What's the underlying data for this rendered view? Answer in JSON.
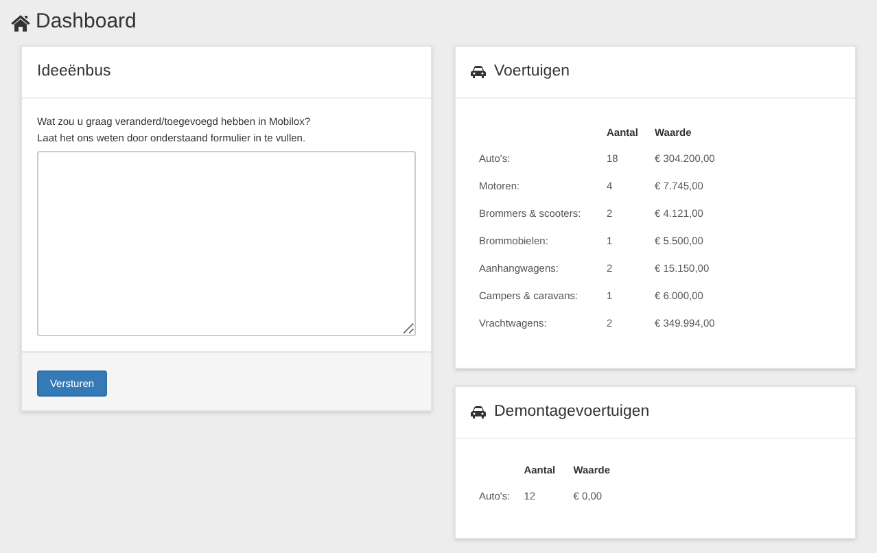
{
  "page_title": "Dashboard",
  "idea_box": {
    "title": "Ideeënbus",
    "intro": [
      "Wat zou u graag veranderd/toegevoegd hebben in Mobilox?",
      "Laat het ons weten door onderstaand formulier in te vullen."
    ],
    "submit": "Versturen"
  },
  "vehicles": {
    "title": "Voertuigen",
    "columns": [
      "Aantal",
      "Waarde"
    ],
    "rows": [
      {
        "label": "Auto's:",
        "count": "18",
        "value": "€ 304.200,00"
      },
      {
        "label": "Motoren:",
        "count": "4",
        "value": "€ 7.745,00"
      },
      {
        "label": "Brommers & scooters:",
        "count": "2",
        "value": "€ 4.121,00"
      },
      {
        "label": "Brommobielen:",
        "count": "1",
        "value": "€ 5.500,00"
      },
      {
        "label": "Aanhangwagens:",
        "count": "2",
        "value": "€ 15.150,00"
      },
      {
        "label": "Campers & caravans:",
        "count": "1",
        "value": "€ 6.000,00"
      },
      {
        "label": "Vrachtwagens:",
        "count": "2",
        "value": "€ 349.994,00"
      }
    ]
  },
  "dismantled": {
    "title": "Demontagevoertuigen",
    "columns": [
      "Aantal",
      "Waarde"
    ],
    "rows": [
      {
        "label": "Auto's:",
        "count": "12",
        "value": "€ 0,00"
      }
    ]
  }
}
